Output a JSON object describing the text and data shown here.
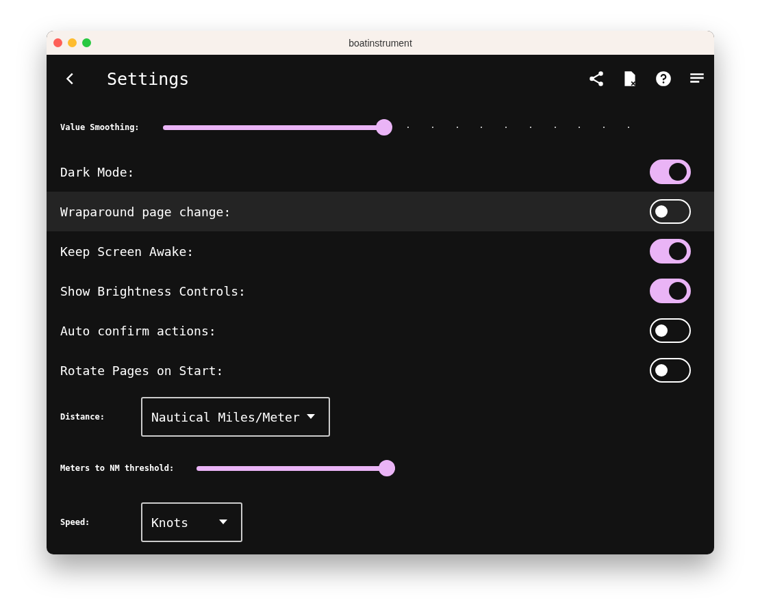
{
  "window": {
    "title": "boatinstrument"
  },
  "app_bar": {
    "title": "Settings"
  },
  "settings": [
    {
      "kind": "slider",
      "label": "Value Smoothing:",
      "level": 0.45
    },
    {
      "kind": "toggle",
      "label": "Dark Mode:",
      "on": true,
      "highlighted": false
    },
    {
      "kind": "toggle",
      "label": "Wraparound page change:",
      "on": false,
      "highlighted": true
    },
    {
      "kind": "toggle",
      "label": "Keep Screen Awake:",
      "on": true,
      "highlighted": false
    },
    {
      "kind": "toggle",
      "label": "Show Brightness Controls:",
      "on": true,
      "highlighted": false
    },
    {
      "kind": "toggle",
      "label": "Auto confirm actions:",
      "on": false,
      "highlighted": false
    },
    {
      "kind": "toggle",
      "label": "Rotate Pages on Start:",
      "on": false,
      "highlighted": false
    },
    {
      "kind": "dropdown",
      "label": "Distance:",
      "value": "Nautical Miles/Meter"
    },
    {
      "kind": "slider",
      "label": "Meters to NM threshold:",
      "level": 1
    },
    {
      "kind": "dropdown",
      "label": "Speed:",
      "value": "Knots"
    }
  ]
}
